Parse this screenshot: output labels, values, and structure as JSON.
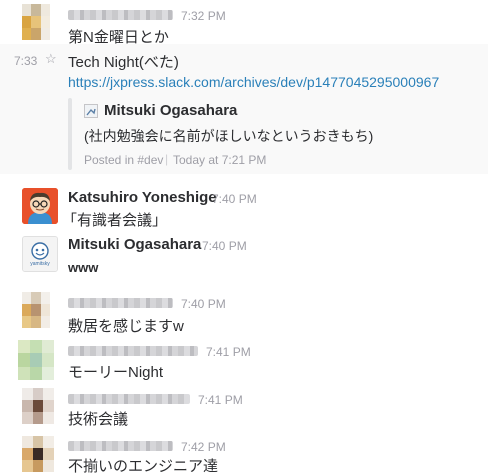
{
  "messages": [
    {
      "time": "7:32 PM",
      "text": "第N金曜日とか"
    },
    {
      "time_left": "7:33",
      "star": "☆",
      "text": "Tech Night(べた)",
      "link": "https://jxpress.slack.com/archives/dev/p1477045295000967",
      "attachment": {
        "author": "Mitsuki Ogasahara",
        "text": "(社内勉強会に名前がほしいなというおきもち)",
        "footer_channel": "Posted in #dev",
        "footer_sep": "|",
        "footer_time": "Today at 7:21 PM"
      }
    },
    {
      "name": "Katsuhiro Yoneshige",
      "time": "7:40 PM",
      "text": "「有識者会議」"
    },
    {
      "name": "Mitsuki Ogasahara",
      "time": "7:40 PM",
      "text": "www",
      "avatar_caption": "yamitsky"
    },
    {
      "time": "7:40 PM",
      "text": "敷居を感じますw"
    },
    {
      "time": "7:41 PM",
      "text": "モーリーNight"
    },
    {
      "time": "7:41 PM",
      "text": "技術会議"
    },
    {
      "time": "7:42 PM",
      "text": "不揃いのエンジニア達"
    }
  ],
  "colors": {
    "link": "#2a80b9",
    "muted": "#9e9ea6",
    "accent_bar": "#e3e4e6"
  }
}
